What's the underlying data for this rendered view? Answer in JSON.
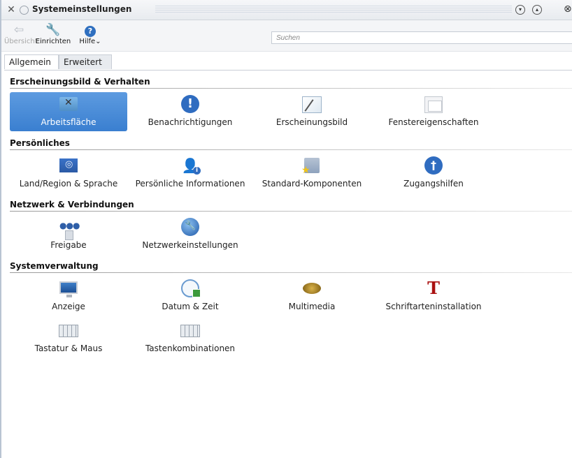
{
  "window": {
    "title": "Systemeinstellungen"
  },
  "toolbar": {
    "back_label": "Übersicht",
    "setup_label": "Einrichten",
    "help_label": "Hilfe",
    "search_placeholder": "Suchen"
  },
  "tabs": [
    {
      "label": "Allgemein",
      "active": true
    },
    {
      "label": "Erweitert",
      "active": false
    }
  ],
  "sections": [
    {
      "title": "Erscheinungsbild & Verhalten",
      "items": [
        {
          "label": "Arbeitsfläche",
          "icon": "desktop-icon",
          "selected": true
        },
        {
          "label": "Benachrichtigungen",
          "icon": "notification-icon"
        },
        {
          "label": "Erscheinungsbild",
          "icon": "appearance-icon"
        },
        {
          "label": "Fenstereigenschaften",
          "icon": "window-properties-icon"
        }
      ]
    },
    {
      "title": "Persönliches",
      "items": [
        {
          "label": "Land/Region & Sprache",
          "icon": "flag-icon"
        },
        {
          "label": "Persönliche Informationen",
          "icon": "personal-info-icon"
        },
        {
          "label": "Standard-Komponenten",
          "icon": "default-components-icon"
        },
        {
          "label": "Zugangshilfen",
          "icon": "accessibility-icon"
        }
      ]
    },
    {
      "title": "Netzwerk & Verbindungen",
      "items": [
        {
          "label": "Freigabe",
          "icon": "sharing-icon"
        },
        {
          "label": "Netzwerkeinstellungen",
          "icon": "network-settings-icon"
        }
      ]
    },
    {
      "title": "Systemverwaltung",
      "items": [
        {
          "label": "Anzeige",
          "icon": "display-icon"
        },
        {
          "label": "Datum & Zeit",
          "icon": "clock-icon"
        },
        {
          "label": "Multimedia",
          "icon": "speaker-icon"
        },
        {
          "label": "Schriftarteninstallation",
          "icon": "font-icon"
        },
        {
          "label": "Tastatur & Maus",
          "icon": "keyboard-icon"
        },
        {
          "label": "Tastenkombinationen",
          "icon": "shortcuts-icon"
        }
      ]
    }
  ],
  "colors": {
    "selection": "#3a7fd0",
    "accent": "#2f6cc0"
  }
}
